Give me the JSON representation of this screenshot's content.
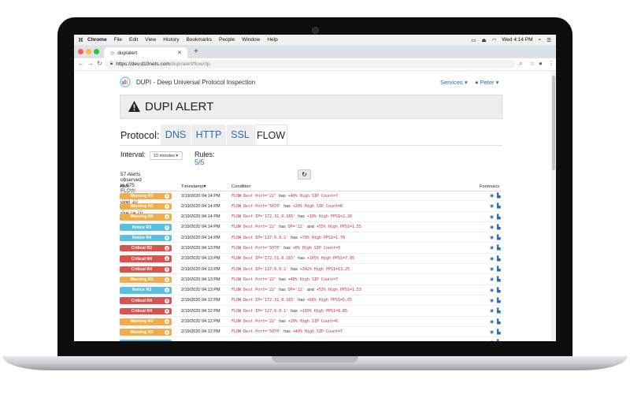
{
  "menubar": {
    "app": "Chrome",
    "items": [
      "File",
      "Edit",
      "View",
      "History",
      "Bookmarks",
      "People",
      "Window",
      "Help"
    ],
    "clock": "Wed 4:14 PM"
  },
  "browser": {
    "tab_title": "dupialert",
    "url_host": "https://dev.d10nets.com",
    "url_path": "/dupi/alert/flow/rlp"
  },
  "header": {
    "brand": "DUPI - Deep Universal Protocol Inspection",
    "services": "Services ▾",
    "user": "Peter ▾"
  },
  "alert_title": "DUPI ALERT",
  "protocol": {
    "label": "Protocol:",
    "tabs": [
      "DNS",
      "HTTP",
      "SSL",
      "FLOW"
    ],
    "active": "FLOW"
  },
  "interval": {
    "label": "Interval:",
    "value": "10 minutes ▾"
  },
  "rules": {
    "label": "Rules:",
    "value": "5/5"
  },
  "summary": "57 Alerts observed in 675 FLOW records over 10 minutes @4:14:20 PM",
  "table": {
    "headers": [
      "Alert",
      "Timestamp▾",
      "Condition",
      "Forensics"
    ],
    "rows": [
      {
        "badge": "Warning R2",
        "color": "#f0ad4e",
        "count": "3",
        "ts": "2/19/2020 04:14 PM",
        "c1": "FLOW Dest Port='22'",
        "j1": "has",
        "c2": "+40% High SIP Count=7",
        "j2": "",
        "c3": ""
      },
      {
        "badge": "Warning R2",
        "color": "#f0ad4e",
        "count": "3",
        "ts": "2/19/2020 04:14 PM",
        "c1": "FLOW Dest Port='5070'",
        "j1": "has",
        "c2": "+20% High SIP Count=6",
        "j2": "",
        "c3": ""
      },
      {
        "badge": "Warning R4",
        "color": "#f0ad4e",
        "count": "3",
        "ts": "2/19/2020 04:14 PM",
        "c1": "FLOW Dest IP='172.31.0.165'",
        "j1": "has",
        "c2": "+10% High PPS1=2.20",
        "j2": "",
        "c3": ""
      },
      {
        "badge": "Notice R3",
        "color": "#5bc0de",
        "count": "3",
        "ts": "2/19/2020 04:14 PM",
        "c1": "FLOW Dest Port='22'",
        "j1": "has",
        "c2": "DP='22'",
        "j2": "and",
        "c3": "+55% High PPS1=1.55"
      },
      {
        "badge": "Notice R4",
        "color": "#5bc0de",
        "count": "3",
        "ts": "2/19/2020 04:14 PM",
        "c1": "FLOW Dest IP='127.0.0.1'",
        "j1": "has",
        "c2": "+70% High PPS1=1.70",
        "j2": "",
        "c3": ""
      },
      {
        "badge": "Critical R2",
        "color": "#d9534f",
        "count": "3",
        "ts": "2/19/2020 04:13 PM",
        "c1": "FLOW Dest Port='5070'",
        "j1": "has",
        "c2": "+0% High SIP Count=0",
        "j2": "",
        "c3": ""
      },
      {
        "badge": "Critical R4",
        "color": "#d9534f",
        "count": "3",
        "ts": "2/19/2020 04:13 PM",
        "c1": "FLOW Dest IP='172.31.0.165'",
        "j1": "has",
        "c2": "+165% High PPS1=7.95",
        "j2": "",
        "c3": ""
      },
      {
        "badge": "Critical R4",
        "color": "#d9534f",
        "count": "3",
        "ts": "2/19/2020 04:13 PM",
        "c1": "FLOW Dest IP='127.0.0.1'",
        "j1": "has",
        "c2": "+342% High PPS1=13.25",
        "j2": "",
        "c3": ""
      },
      {
        "badge": "Warning R2",
        "color": "#f0ad4e",
        "count": "3",
        "ts": "2/19/2020 04:13 PM",
        "c1": "FLOW Dest Port='22'",
        "j1": "has",
        "c2": "+40% High SIP Count=7",
        "j2": "",
        "c3": ""
      },
      {
        "badge": "Notice R3",
        "color": "#5bc0de",
        "count": "3",
        "ts": "2/19/2020 04:13 PM",
        "c1": "FLOW Dest Port='22'",
        "j1": "has",
        "c2": "DP='22'",
        "j2": "and",
        "c3": "+53% High PPS1=1.53"
      },
      {
        "badge": "Critical R4",
        "color": "#d9534f",
        "count": "3",
        "ts": "2/19/2020 04:12 PM",
        "c1": "FLOW Dest IP='172.31.0.165'",
        "j1": "has",
        "c2": "+68% High PPS1=5.05",
        "j2": "",
        "c3": ""
      },
      {
        "badge": "Critical R4",
        "color": "#d9534f",
        "count": "3",
        "ts": "2/19/2020 04:12 PM",
        "c1": "FLOW Dest IP='127.0.0.1'",
        "j1": "has",
        "c2": "+160% High PPS1=8.85",
        "j2": "",
        "c3": ""
      },
      {
        "badge": "Warning R2",
        "color": "#f0ad4e",
        "count": "3",
        "ts": "2/19/2020 04:12 PM",
        "c1": "FLOW Dest Port='22'",
        "j1": "has",
        "c2": "+20% High SIP Count=6",
        "j2": "",
        "c3": ""
      },
      {
        "badge": "Warning R2",
        "color": "#f0ad4e",
        "count": "3",
        "ts": "2/19/2020 04:12 PM",
        "c1": "FLOW Dest Port='5070'",
        "j1": "has",
        "c2": "+40% High SIP Count=7",
        "j2": "",
        "c3": ""
      },
      {
        "badge": "",
        "color": "#5bc0de",
        "count": "",
        "ts": "",
        "c1": "",
        "j1": "",
        "c2": "",
        "j2": "",
        "c3": ""
      }
    ]
  }
}
